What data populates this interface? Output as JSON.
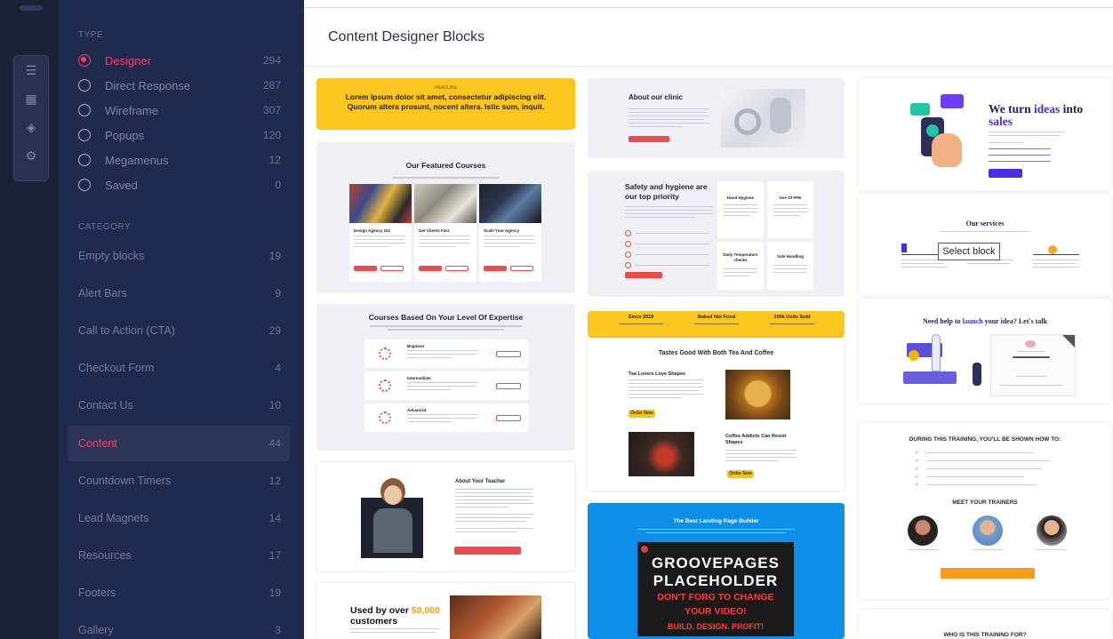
{
  "page": {
    "title": "Content Designer Blocks"
  },
  "filters": {
    "type_heading": "TYPE",
    "types": [
      {
        "label": "Designer",
        "count": "294",
        "selected": true
      },
      {
        "label": "Direct Response",
        "count": "287",
        "selected": false
      },
      {
        "label": "Wireframe",
        "count": "307",
        "selected": false
      },
      {
        "label": "Popups",
        "count": "120",
        "selected": false
      },
      {
        "label": "Megamenus",
        "count": "12",
        "selected": false
      },
      {
        "label": "Saved",
        "count": "0",
        "selected": false
      }
    ],
    "category_heading": "CATEGORY",
    "categories": [
      {
        "label": "Empty blocks",
        "count": "19"
      },
      {
        "label": "Alert Bars",
        "count": "9"
      },
      {
        "label": "Call to Action (CTA)",
        "count": "29"
      },
      {
        "label": "Checkout Form",
        "count": "4"
      },
      {
        "label": "Contact Us",
        "count": "10"
      },
      {
        "label": "Content",
        "count": "44",
        "active": true
      },
      {
        "label": "Countdown Timers",
        "count": "12"
      },
      {
        "label": "Lead Magnets",
        "count": "14"
      },
      {
        "label": "Resources",
        "count": "17"
      },
      {
        "label": "Footers",
        "count": "19"
      },
      {
        "label": "Gallery",
        "count": "3"
      }
    ]
  },
  "rail": {
    "tools": [
      "pages-icon",
      "blocks-icon",
      "layers-icon",
      "settings-icon"
    ]
  },
  "blocks": {
    "lorem": {
      "small": "HEADLINE",
      "text": "Lorem ipsum dolor sit amet, consectetur adipiscing elit. Quorum altera prosunt, nocent altera. Istic sum, inquit."
    },
    "featured": {
      "title": "Our Featured Courses",
      "courses": [
        "Design Agency 101",
        "Get Clients Fast",
        "Scale Your Agency"
      ]
    },
    "expertise": {
      "title": "Courses Based On Your Level Of Expertise",
      "levels": [
        "Beginner",
        "Intermediate",
        "Advanced"
      ]
    },
    "teacher": {
      "title": "About Your Teacher"
    },
    "used": {
      "title_pre": "Used by over ",
      "highlight": "50,000",
      "title_post": "customers"
    },
    "clinic": {
      "title": "About our clinic"
    },
    "safety": {
      "title": "Safety and hygiene are our top priority",
      "cards": [
        "Hand Hygiene",
        "Use Of PPE",
        "Daily Temperature checks",
        "Safe Handling"
      ]
    },
    "stats": [
      "Since 2019",
      "Baked Not Fried",
      "100k Units Sold"
    ],
    "tea": {
      "title": "Tastes Good With Both Tea And Coffee",
      "item1": "Tea Lovers Love Shapes",
      "item2": "Coffee Addicts Can Resist Shapes",
      "button": "Order Now"
    },
    "landing": {
      "title": "The Best Landing Page Builder",
      "ph1": "GROOVEPAGES",
      "ph2": "PLACEHOLDER",
      "ph3": "DON'T FORG  TO CHANGE",
      "ph4": "YOUR VIDEO!",
      "ph5": "BUILD. DESIGN. PROFIT!"
    },
    "ideas": {
      "pre": "We turn ",
      "highlight": "ideas",
      "mid": " into",
      "last": "sales"
    },
    "services": {
      "title": "Our services",
      "tooltip": "Select block"
    },
    "launch": {
      "pre": "Need help to ",
      "highlight": "launch",
      "post": " your idea? Let's talk"
    },
    "training": {
      "title": "DURING THIS TRAINING, YOU'LL BE SHOWN HOW TO:",
      "trainers": "MEET YOUR TRAINERS",
      "who": "WHO IS THIS TRAINING FOR?"
    }
  },
  "colors": {
    "accent": "#ff3d66",
    "panel": "#1e2a4e",
    "yellow": "#fcc621",
    "purple": "#4b2be6",
    "blue": "#0d8ee9"
  }
}
